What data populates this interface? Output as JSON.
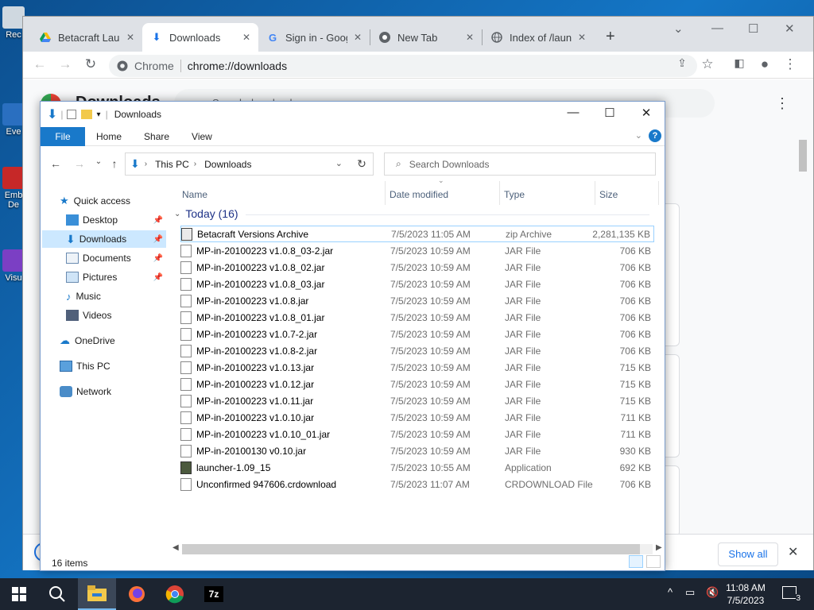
{
  "desktop": {
    "icons": [
      {
        "label": "Rec"
      },
      {
        "label": "Eve"
      },
      {
        "label": "Emb De"
      },
      {
        "label": "Visu"
      }
    ]
  },
  "chrome": {
    "tabs": [
      {
        "label": "Betacraft Launcher",
        "icon": "google-drive-icon"
      },
      {
        "label": "Downloads",
        "icon": "download-icon"
      },
      {
        "label": "Sign in - Google",
        "icon": "google-g-icon"
      },
      {
        "label": "New Tab",
        "icon": "chrome-icon"
      },
      {
        "label": "Index of /launcher",
        "icon": "globe-icon"
      }
    ],
    "omnibox": {
      "chip": "Chrome",
      "url": "chrome://downloads"
    },
    "page_title": "Downloads",
    "search_placeholder": "Search downloads",
    "show_all": "Show all"
  },
  "explorer": {
    "title": "Downloads",
    "ribbon_tabs": [
      "File",
      "Home",
      "Share",
      "View"
    ],
    "breadcrumb": [
      "This PC",
      "Downloads"
    ],
    "search_placeholder": "Search Downloads",
    "nav": {
      "quick_access": "Quick access",
      "items": [
        {
          "label": "Desktop",
          "pinned": true
        },
        {
          "label": "Downloads",
          "pinned": true
        },
        {
          "label": "Documents",
          "pinned": true
        },
        {
          "label": "Pictures",
          "pinned": true
        },
        {
          "label": "Music",
          "pinned": false
        },
        {
          "label": "Videos",
          "pinned": false
        }
      ],
      "onedrive": "OneDrive",
      "this_pc": "This PC",
      "network": "Network"
    },
    "columns": [
      "Name",
      "Date modified",
      "Type",
      "Size"
    ],
    "group_label": "Today (16)",
    "files": [
      {
        "name": "Betacraft Versions Archive",
        "date": "7/5/2023 11:05 AM",
        "type": "zip Archive",
        "size": "2,281,135 KB",
        "kind": "archive"
      },
      {
        "name": "MP-in-20100223 v1.0.8_03-2.jar",
        "date": "7/5/2023 10:59 AM",
        "type": "JAR File",
        "size": "706 KB",
        "kind": "file"
      },
      {
        "name": "MP-in-20100223 v1.0.8_02.jar",
        "date": "7/5/2023 10:59 AM",
        "type": "JAR File",
        "size": "706 KB",
        "kind": "file"
      },
      {
        "name": "MP-in-20100223 v1.0.8_03.jar",
        "date": "7/5/2023 10:59 AM",
        "type": "JAR File",
        "size": "706 KB",
        "kind": "file"
      },
      {
        "name": "MP-in-20100223 v1.0.8.jar",
        "date": "7/5/2023 10:59 AM",
        "type": "JAR File",
        "size": "706 KB",
        "kind": "file"
      },
      {
        "name": "MP-in-20100223 v1.0.8_01.jar",
        "date": "7/5/2023 10:59 AM",
        "type": "JAR File",
        "size": "706 KB",
        "kind": "file"
      },
      {
        "name": "MP-in-20100223 v1.0.7-2.jar",
        "date": "7/5/2023 10:59 AM",
        "type": "JAR File",
        "size": "706 KB",
        "kind": "file"
      },
      {
        "name": "MP-in-20100223 v1.0.8-2.jar",
        "date": "7/5/2023 10:59 AM",
        "type": "JAR File",
        "size": "706 KB",
        "kind": "file"
      },
      {
        "name": "MP-in-20100223 v1.0.13.jar",
        "date": "7/5/2023 10:59 AM",
        "type": "JAR File",
        "size": "715 KB",
        "kind": "file"
      },
      {
        "name": "MP-in-20100223 v1.0.12.jar",
        "date": "7/5/2023 10:59 AM",
        "type": "JAR File",
        "size": "715 KB",
        "kind": "file"
      },
      {
        "name": "MP-in-20100223 v1.0.11.jar",
        "date": "7/5/2023 10:59 AM",
        "type": "JAR File",
        "size": "715 KB",
        "kind": "file"
      },
      {
        "name": "MP-in-20100223 v1.0.10.jar",
        "date": "7/5/2023 10:59 AM",
        "type": "JAR File",
        "size": "711 KB",
        "kind": "file"
      },
      {
        "name": "MP-in-20100223 v1.0.10_01.jar",
        "date": "7/5/2023 10:59 AM",
        "type": "JAR File",
        "size": "711 KB",
        "kind": "file"
      },
      {
        "name": "MP-in-20100130 v0.10.jar",
        "date": "7/5/2023 10:59 AM",
        "type": "JAR File",
        "size": "930 KB",
        "kind": "file"
      },
      {
        "name": "launcher-1.09_15",
        "date": "7/5/2023 10:55 AM",
        "type": "Application",
        "size": "692 KB",
        "kind": "app"
      },
      {
        "name": "Unconfirmed 947606.crdownload",
        "date": "7/5/2023 11:07 AM",
        "type": "CRDOWNLOAD File",
        "size": "706 KB",
        "kind": "file"
      }
    ],
    "status": "16 items"
  },
  "taskbar": {
    "time": "11:08 AM",
    "date": "7/5/2023",
    "notifications": "3",
    "apps": [
      "start-icon",
      "search-icon",
      "file-explorer-icon",
      "firefox-icon",
      "chrome-icon",
      "7zip-icon"
    ]
  },
  "colors": {
    "accent": "#1979ca",
    "selection": "#cce8ff",
    "taskbar": "#1c2430",
    "group_header": "#1e3287"
  }
}
